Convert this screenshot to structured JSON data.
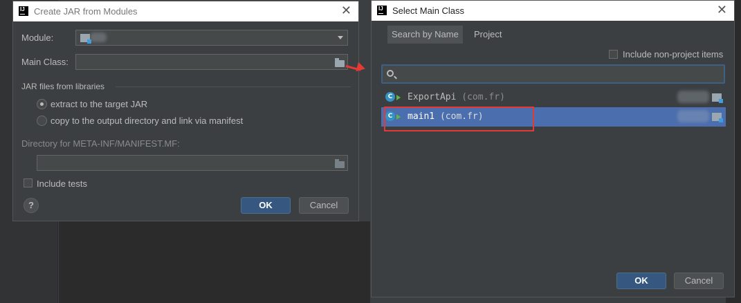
{
  "left_dialog": {
    "title": "Create JAR from Modules",
    "module_label": "Module:",
    "main_class_label": "Main Class:",
    "main_class_value": "",
    "jar_files_label": "JAR files from libraries",
    "option_extract": "extract to the target JAR",
    "option_copy": "copy to the output directory and link via manifest",
    "manifest_label": "Directory for META-INF/MANIFEST.MF:",
    "manifest_value": "",
    "include_tests": "Include tests",
    "ok": "OK",
    "cancel": "Cancel",
    "help": "?"
  },
  "right_dialog": {
    "title": "Select Main Class",
    "tabs": [
      "Search by Name",
      "Project"
    ],
    "include_non_project": "Include non-project items",
    "search_value": "",
    "items": [
      {
        "name": "ExportApi",
        "pkg": "(com.fr)",
        "selected": false
      },
      {
        "name": "main1",
        "pkg": "(com.fr)",
        "selected": true
      }
    ],
    "ok": "OK",
    "cancel": "Cancel"
  },
  "icons": {
    "app": "intellij-icon",
    "close": "close-icon",
    "folder": "folder-icon",
    "search": "search-icon",
    "class": "class-icon",
    "run": "run-icon",
    "module": "module-icon"
  },
  "colors": {
    "accent": "#365880",
    "selection": "#4b6eaf",
    "highlight": "#e53935"
  }
}
